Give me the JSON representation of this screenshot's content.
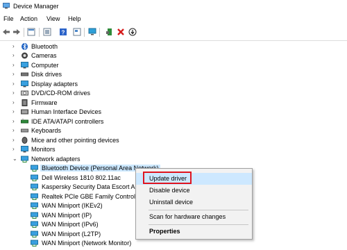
{
  "window": {
    "title": "Device Manager"
  },
  "menu": [
    "File",
    "Action",
    "View",
    "Help"
  ],
  "toolbar": {
    "icons": [
      "back-icon",
      "forward-icon",
      "properties-icon",
      "show-hidden-icon",
      "help-icon",
      "details-icon",
      "monitor-icon",
      "add-driver-icon",
      "uninstall-icon",
      "update-driver-icon"
    ]
  },
  "tree": {
    "items": [
      {
        "label": "Bluetooth",
        "icon": "bluetooth-icon"
      },
      {
        "label": "Cameras",
        "icon": "camera-icon"
      },
      {
        "label": "Computer",
        "icon": "computer-icon"
      },
      {
        "label": "Disk drives",
        "icon": "disk-drive-icon"
      },
      {
        "label": "Display adapters",
        "icon": "display-adapter-icon"
      },
      {
        "label": "DVD/CD-ROM drives",
        "icon": "dvd-icon"
      },
      {
        "label": "Firmware",
        "icon": "firmware-icon"
      },
      {
        "label": "Human Interface Devices",
        "icon": "hid-icon"
      },
      {
        "label": "IDE ATA/ATAPI controllers",
        "icon": "ide-icon"
      },
      {
        "label": "Keyboards",
        "icon": "keyboard-icon"
      },
      {
        "label": "Mice and other pointing devices",
        "icon": "mouse-icon"
      },
      {
        "label": "Monitors",
        "icon": "monitor-icon"
      },
      {
        "label": "Network adapters",
        "icon": "network-adapter-icon"
      }
    ],
    "network_children": [
      "Bluetooth Device (Personal Area Network)",
      "Dell Wireless 1810 802.11ac",
      "Kaspersky Security Data Escort A",
      "Realtek PCIe GBE Family Controll",
      "WAN Miniport (IKEv2)",
      "WAN Miniport (IP)",
      "WAN Miniport (IPv6)",
      "WAN Miniport (L2TP)",
      "WAN Miniport (Network Monitor)"
    ]
  },
  "context_menu": {
    "items": [
      "Update driver",
      "Disable device",
      "Uninstall device",
      "Scan for hardware changes",
      "Properties"
    ],
    "highlight_color": "#e0141e"
  }
}
